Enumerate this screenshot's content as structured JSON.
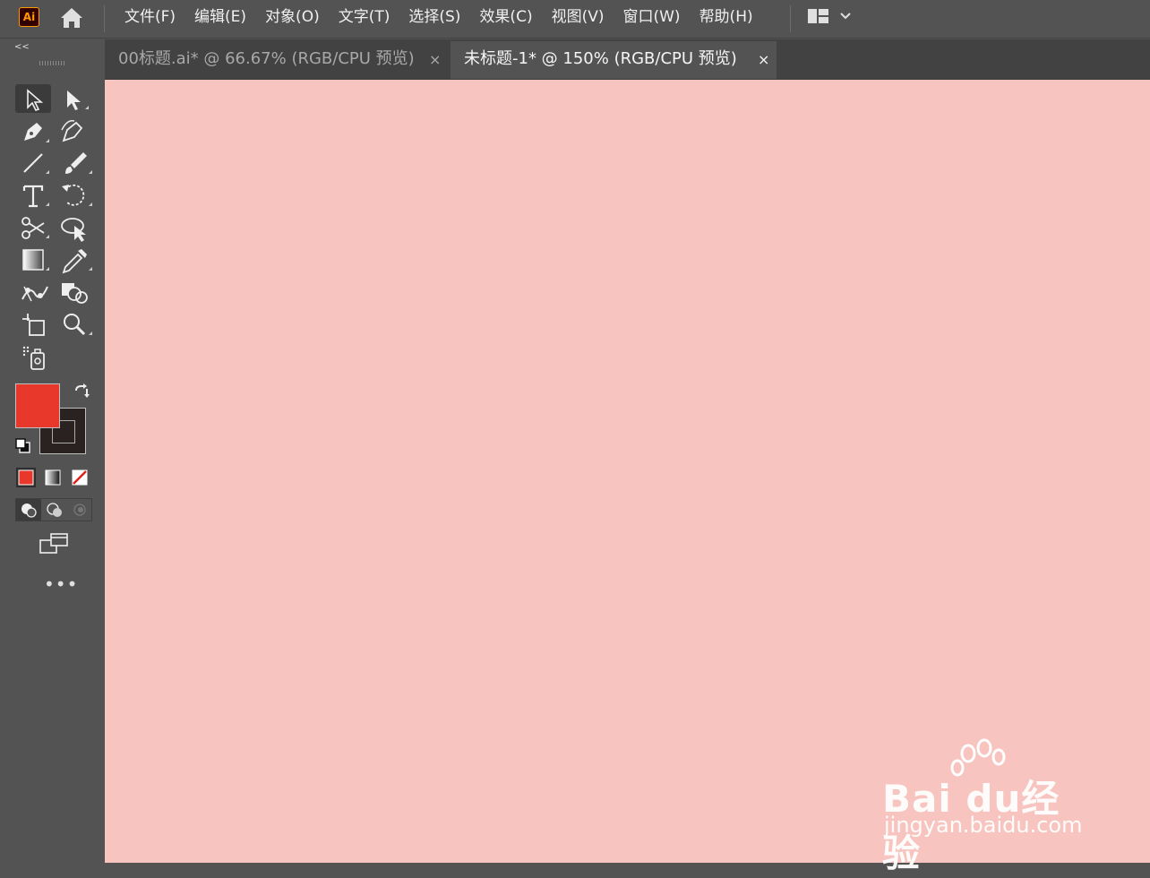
{
  "app": {
    "logo_text": "Ai"
  },
  "menu": {
    "items": [
      "文件(F)",
      "编辑(E)",
      "对象(O)",
      "文字(T)",
      "选择(S)",
      "效果(C)",
      "视图(V)",
      "窗口(W)",
      "帮助(H)"
    ]
  },
  "toolbar": {
    "collapse_label": "<<",
    "more_label": "•••",
    "fill_color": "#e8372b",
    "stroke_color": "#2a2220"
  },
  "tabs": [
    {
      "title": "00标题.ai* @ 66.67% (RGB/CPU 预览)",
      "close": "×",
      "active": false
    },
    {
      "title": "未标题-1* @ 150% (RGB/CPU 预览)",
      "close": "×",
      "active": true
    }
  ],
  "canvas": {
    "background": "#f7c4bf"
  },
  "watermark": {
    "brand": "Bai du经验",
    "url": "jingyan.baidu.com"
  }
}
